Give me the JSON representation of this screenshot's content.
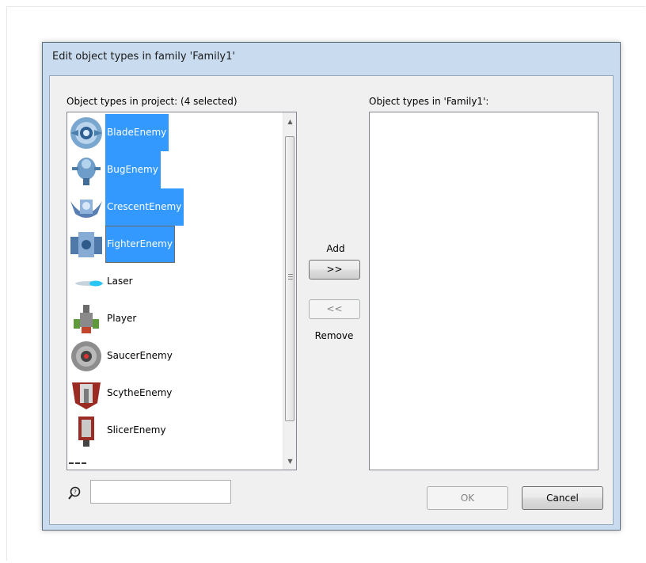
{
  "dialog": {
    "title": "Edit object types in family 'Family1'"
  },
  "left_panel": {
    "label": "Object types in project: (4 selected)",
    "items": [
      {
        "label": "BladeEnemy",
        "selected": true,
        "icon": "blade-enemy-icon"
      },
      {
        "label": "BugEnemy",
        "selected": true,
        "icon": "bug-enemy-icon"
      },
      {
        "label": "CrescentEnemy",
        "selected": true,
        "icon": "crescent-enemy-icon"
      },
      {
        "label": "FighterEnemy",
        "selected": true,
        "icon": "fighter-enemy-icon"
      },
      {
        "label": "Laser",
        "selected": false,
        "icon": "laser-icon"
      },
      {
        "label": "Player",
        "selected": false,
        "icon": "player-icon"
      },
      {
        "label": "SaucerEnemy",
        "selected": false,
        "icon": "saucer-enemy-icon"
      },
      {
        "label": "ScytheEnemy",
        "selected": false,
        "icon": "scythe-enemy-icon"
      },
      {
        "label": "SlicerEnemy",
        "selected": false,
        "icon": "slicer-enemy-icon"
      }
    ]
  },
  "right_panel": {
    "label": "Object types in 'Family1':",
    "items": []
  },
  "middle": {
    "add_label": "Add",
    "add_button": ">>",
    "remove_button": "<<",
    "remove_label": "Remove"
  },
  "footer": {
    "search_value": "",
    "ok_label": "OK",
    "cancel_label": "Cancel"
  },
  "colors": {
    "selection": "#3399ff",
    "dialog_frame": "#c9dcef",
    "client_bg": "#f0f0f0"
  }
}
